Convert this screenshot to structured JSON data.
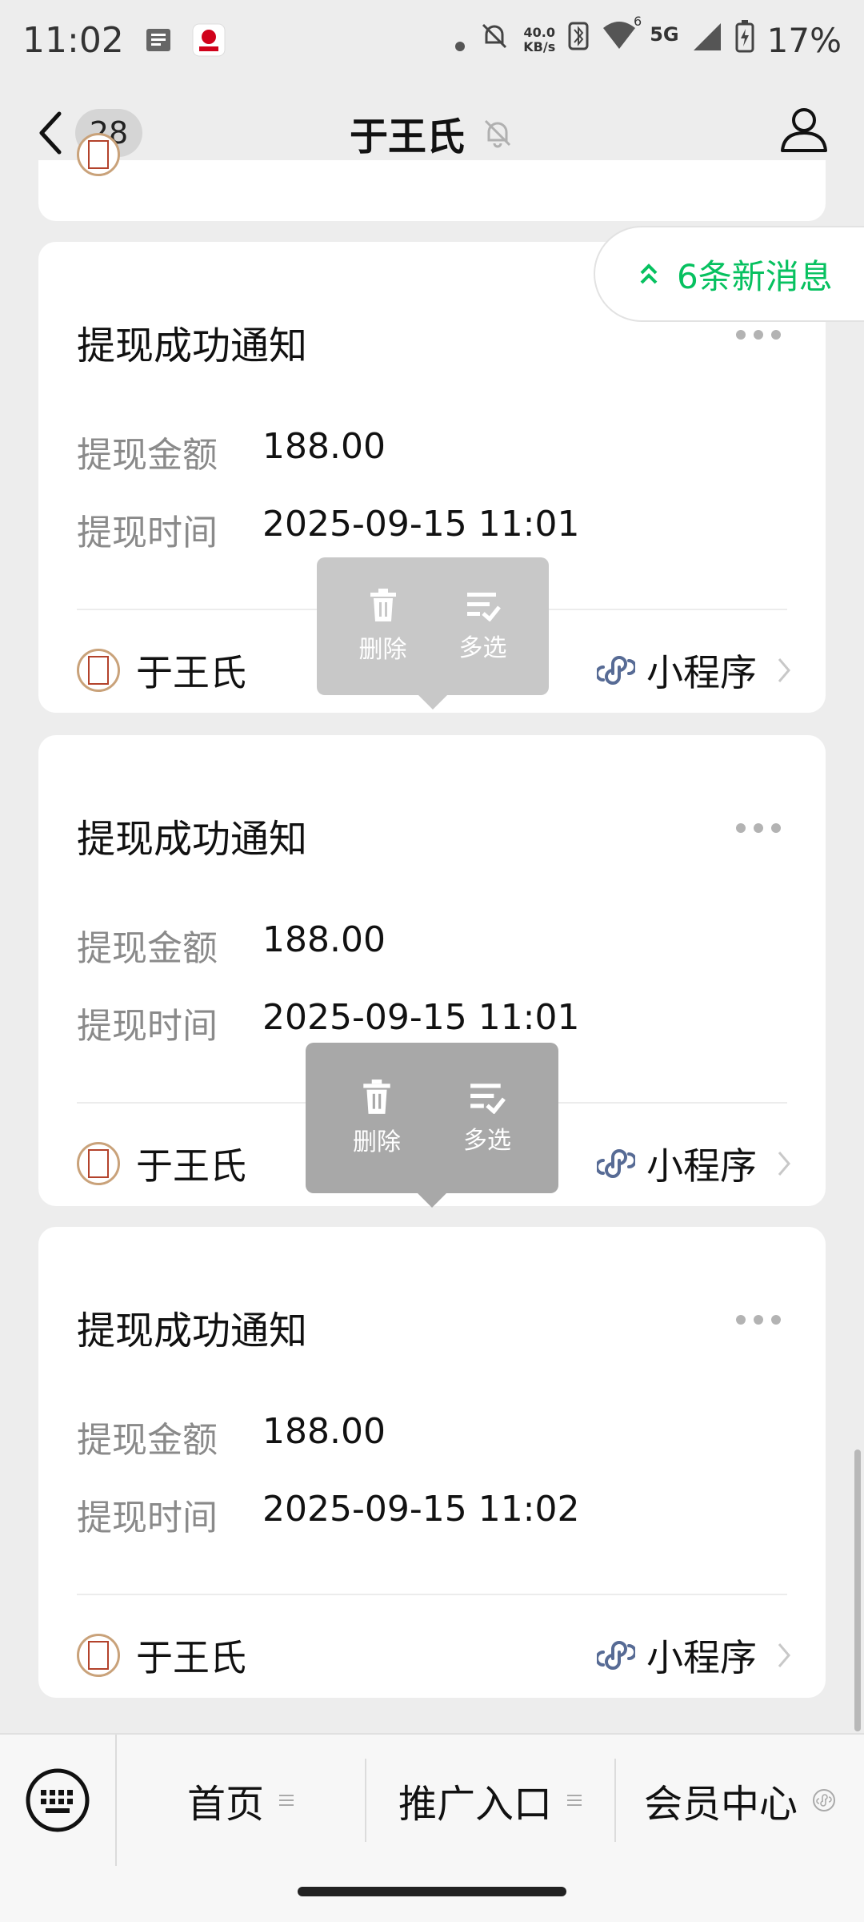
{
  "status_bar": {
    "time": "11:02",
    "net_speed_value": "40.0",
    "net_speed_unit": "KB/s",
    "network": "5G",
    "wifi_sup": "6",
    "battery": "17%"
  },
  "header": {
    "unread_count": "28",
    "title": "于王氏"
  },
  "new_messages": {
    "label": "6条新消息"
  },
  "cards": [
    {
      "title": "提现成功通知",
      "amount_label": "提现金额",
      "amount": "188.00",
      "time_label": "提现时间",
      "time": "2025-09-15 11:01",
      "account": "于王氏",
      "mini_program": "小程序"
    },
    {
      "title": "提现成功通知",
      "amount_label": "提现金额",
      "amount": "188.00",
      "time_label": "提现时间",
      "time": "2025-09-15 11:01",
      "account": "于王氏",
      "mini_program": "小程序"
    },
    {
      "title": "提现成功通知",
      "amount_label": "提现金额",
      "amount": "188.00",
      "time_label": "提现时间",
      "time": "2025-09-15 11:02",
      "account": "于王氏",
      "mini_program": "小程序"
    }
  ],
  "context_menu": {
    "delete": "删除",
    "multi_select": "多选"
  },
  "bottom_menu": [
    "首页",
    "推广入口",
    "会员中心"
  ],
  "colors": {
    "accent_green": "#07c160",
    "link_blue": "#576b95"
  }
}
